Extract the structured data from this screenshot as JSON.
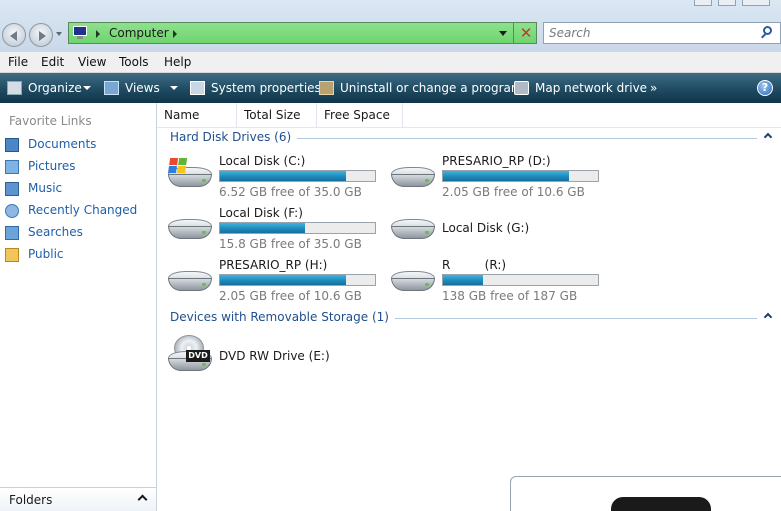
{
  "address": {
    "path": "Computer",
    "search_placeholder": "Search"
  },
  "menu": [
    "File",
    "Edit",
    "View",
    "Tools",
    "Help"
  ],
  "toolbar": {
    "organize": "Organize",
    "views": "Views",
    "system_properties": "System properties",
    "uninstall": "Uninstall or change a program",
    "map_drive": "Map network drive",
    "more": "»",
    "help": "?"
  },
  "sidebar": {
    "title": "Favorite Links",
    "items": [
      {
        "label": "Documents",
        "icon": "documents-icon"
      },
      {
        "label": "Pictures",
        "icon": "pictures-icon"
      },
      {
        "label": "Music",
        "icon": "music-icon"
      },
      {
        "label": "Recently Changed",
        "icon": "recently-changed-icon"
      },
      {
        "label": "Searches",
        "icon": "searches-icon"
      },
      {
        "label": "Public",
        "icon": "public-folder-icon"
      }
    ],
    "folders": "Folders"
  },
  "columns": [
    "Name",
    "Total Size",
    "Free Space"
  ],
  "groups": {
    "hdd": "Hard Disk Drives (6)",
    "removable": "Devices with Removable Storage (1)"
  },
  "drives": [
    {
      "name": "Local Disk (C:)",
      "free": "6.52 GB free of 35.0 GB",
      "used_fraction": 0.81,
      "system": true
    },
    {
      "name": "PRESARIO_RP (D:)",
      "free": "2.05 GB free of 10.6 GB",
      "used_fraction": 0.81
    },
    {
      "name": "Local Disk (F:)",
      "free": "15.8 GB free of 35.0 GB",
      "used_fraction": 0.55
    },
    {
      "name": "Local Disk (G:)"
    },
    {
      "name": "PRESARIO_RP (H:)",
      "free": "2.05 GB free of 10.6 GB",
      "used_fraction": 0.81
    },
    {
      "name": "R         (R:)",
      "free": "138 GB free of 187 GB",
      "used_fraction": 0.26
    }
  ],
  "removable": [
    {
      "name": "DVD RW Drive (E:)",
      "icon_label": "DVD"
    }
  ],
  "colors": {
    "address_bar": "#7ad97a",
    "command_bar": "#1f4b62",
    "link": "#1f5fa8",
    "drive_fill": "#1d86b6"
  }
}
